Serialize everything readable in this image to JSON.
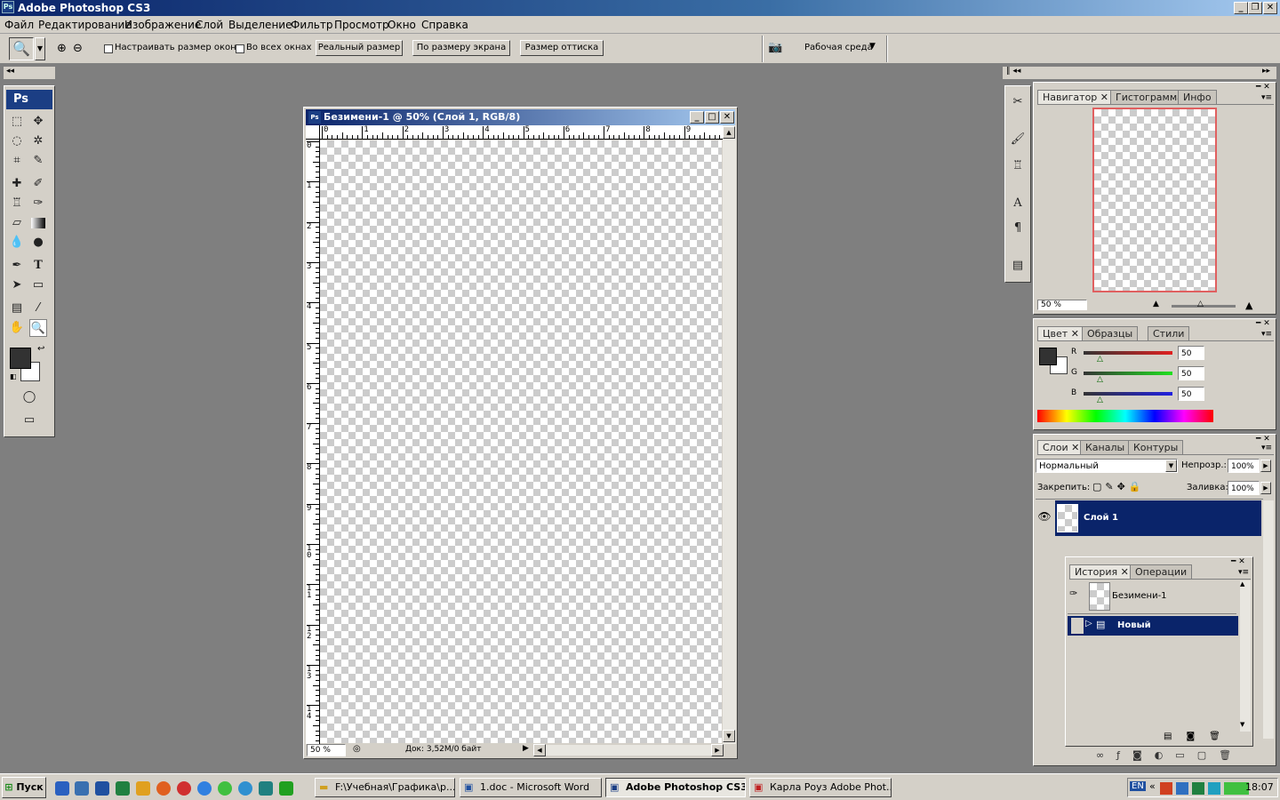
{
  "app": {
    "title": "Adobe Photoshop CS3",
    "logo": "Ps"
  },
  "menu": [
    "Файл",
    "Редактирование",
    "Изображение",
    "Слой",
    "Выделение",
    "Фильтр",
    "Просмотр",
    "Окно",
    "Справка"
  ],
  "options": {
    "resize_windows": "Настраивать размер окон",
    "all_windows": "Во всех окнах",
    "actual_pixels": "Реальный размер",
    "fit_screen": "По размеру экрана",
    "print_size": "Размер оттиска",
    "workspace": "Рабочая среда"
  },
  "document": {
    "title": "Безимени-1 @ 50% (Слой 1, RGB/8)",
    "zoom": "50 %",
    "doc_info": "Док: 3,52М/0 байт",
    "h_ruler": [
      "0",
      "1",
      "2",
      "3",
      "4",
      "5",
      "6",
      "7",
      "8",
      "9"
    ],
    "v_ruler": [
      "0",
      "1",
      "2",
      "3",
      "4",
      "5",
      "6",
      "7",
      "8",
      "9",
      "1 0",
      "1 1",
      "1 2",
      "1 3",
      "1 4"
    ]
  },
  "navigator": {
    "tabs": [
      "Навигатор",
      "Гистограмма",
      "Инфо"
    ],
    "zoom": "50 %"
  },
  "color": {
    "tabs": [
      "Цвет",
      "Образцы",
      "Стили"
    ],
    "r_label": "R",
    "g_label": "G",
    "b_label": "B",
    "r": "50",
    "g": "50",
    "b": "50"
  },
  "layers": {
    "tabs": [
      "Слои",
      "Каналы",
      "Контуры"
    ],
    "blend_mode": "Нормальный",
    "opacity_label": "Непрозр.:",
    "opacity": "100%",
    "lock_label": "Закрепить:",
    "fill_label": "Заливка:",
    "fill": "100%",
    "layer_name": "Слой 1"
  },
  "history": {
    "tabs": [
      "История",
      "Операции"
    ],
    "snapshot": "Безимени-1",
    "step": "Новый"
  },
  "taskbar": {
    "start": "Пуск",
    "tasks": [
      "F:\\Учебная\\Графика\\р...",
      "1.doc - Microsoft Word",
      "Adobe Photoshop CS3",
      "Карла Роуз Adobe Phot..."
    ],
    "lang": "EN",
    "clock": "18:07"
  }
}
